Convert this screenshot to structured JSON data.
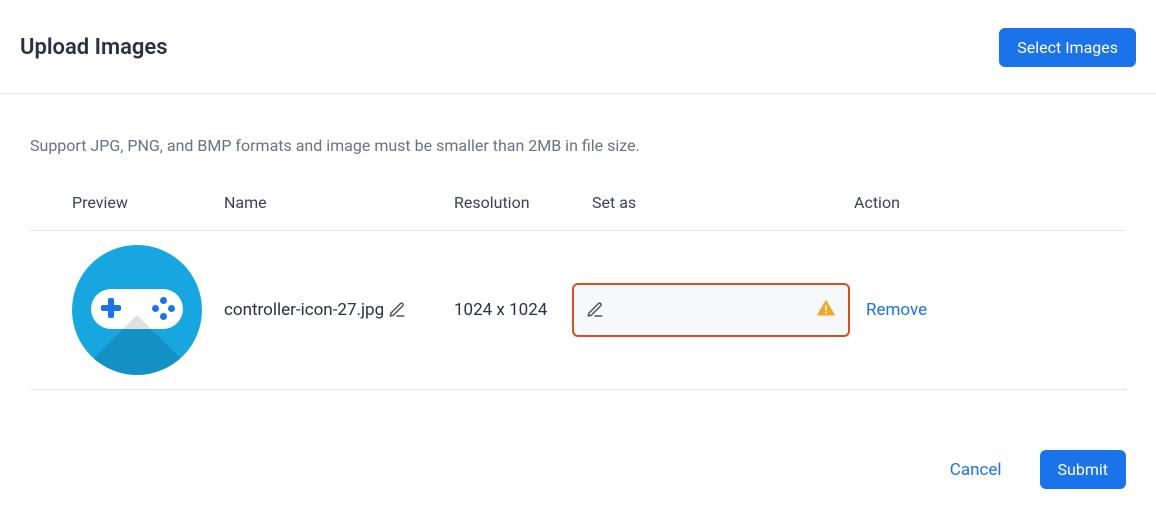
{
  "header": {
    "title": "Upload Images",
    "select_button": "Select Images"
  },
  "help_text": "Support JPG, PNG, and BMP formats and image must be smaller than 2MB in file size.",
  "table": {
    "columns": {
      "preview": "Preview",
      "name": "Name",
      "resolution": "Resolution",
      "set_as": "Set as",
      "action": "Action"
    },
    "rows": [
      {
        "name": "controller-icon-27.jpg",
        "resolution": "1024 x 1024",
        "set_as": "",
        "action_label": "Remove"
      }
    ]
  },
  "footer": {
    "cancel": "Cancel",
    "submit": "Submit"
  }
}
